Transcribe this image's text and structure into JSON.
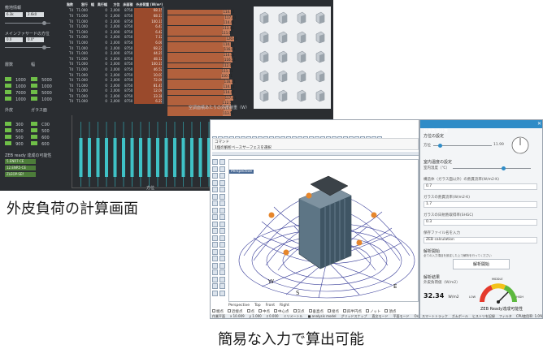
{
  "captions": {
    "left": "外皮負荷の計算画面",
    "right": "簡易な入力で算出可能"
  },
  "dashboard": {
    "sec1_label": "敷地情報",
    "sec1_inputs": [
      "6.3k",
      "2.6k0"
    ],
    "sec2_label": "メインファサードの方位",
    "sec2_inputs": [
      "0.0",
      "0.0°"
    ],
    "group_left_label": "層数",
    "group_right_label": "幅",
    "group_left_values": [
      "1000",
      "1000",
      "7000",
      "1000"
    ],
    "group_right_values": [
      "5000",
      "1000",
      "5000",
      "1000"
    ],
    "group2_left_label": "外皮",
    "group2_right_label": "ガラス面",
    "group2_left_values": [
      "300",
      "500",
      "500",
      "900"
    ],
    "group2_right_values": [
      "C00",
      "500",
      "600",
      "600"
    ],
    "zeb_label": "ZEB ready 達成の可能性",
    "zeb_values": [
      "5.ENR7-CE",
      "12.ENR5-CE",
      "ZLEOP-SEf"
    ],
    "table_headers": [
      "階数",
      "窓行",
      "幅",
      "奥行幅",
      "方位",
      "床面積",
      "外皮荷重 (W/m²)"
    ],
    "table_rows": [
      [
        "T4",
        "T1.000",
        "",
        "0",
        "2,000",
        "8750",
        "68.15"
      ],
      [
        "T4",
        "T1.000",
        "",
        "0",
        "2,000",
        "8750",
        "68.17"
      ],
      [
        "T4",
        "T1.000",
        "",
        "0",
        "2,000",
        "8750",
        "100.11"
      ],
      [
        "T4",
        "T1.000",
        "",
        "0",
        "2,000",
        "8750",
        "6.47"
      ],
      [
        "T4",
        "T1.000",
        "",
        "0",
        "2,000",
        "8750",
        "6.42"
      ],
      [
        "T4",
        "T1.000",
        "",
        "0",
        "2,000",
        "8750",
        "7.12"
      ],
      [
        "T4",
        "T1.000",
        "",
        "0",
        "2,000",
        "8750",
        "6.00"
      ],
      [
        "T4",
        "T1.000",
        "",
        "0",
        "2,000",
        "8750",
        "68.22"
      ],
      [
        "T4",
        "T1.000",
        "",
        "0",
        "2,000",
        "8750",
        "44.21"
      ],
      [
        "T4",
        "T1.000",
        "",
        "0",
        "2,000",
        "8750",
        "48.12"
      ],
      [
        "T4",
        "T1.000",
        "",
        "0",
        "2,000",
        "8750",
        "100.11"
      ],
      [
        "T4",
        "T1.000",
        "",
        "0",
        "2,000",
        "8750",
        "46.52"
      ],
      [
        "T4",
        "T1.000",
        "",
        "0",
        "2,000",
        "8750",
        "10.07"
      ],
      [
        "T4",
        "T1.000",
        "",
        "0",
        "2,000",
        "8750",
        "72.06"
      ],
      [
        "T4",
        "T1.000",
        "",
        "0",
        "2,000",
        "8750",
        "81.41"
      ],
      [
        "T4",
        "T1.000",
        "",
        "0",
        "2,000",
        "8750",
        "12.08"
      ],
      [
        "T4",
        "T1.000",
        "",
        "0",
        "2,000",
        "8750",
        "33.38"
      ],
      [
        "T4",
        "T1.000",
        "",
        "0",
        "2,000",
        "8750",
        "6.22"
      ]
    ],
    "bar_values": [
      "114.11",
      "117.41",
      "114.41",
      "113.01",
      "111.07",
      "120.41",
      "114.14",
      "116.01",
      "114.51",
      "116.51",
      "112.67",
      "111.11",
      "110.11",
      "116.11",
      "114.11",
      "114.47",
      "117.61",
      "112.51",
      "114.61",
      "113.51"
    ],
    "bars_caption": "空調面積あたりの外皮荷重（W）",
    "chart_caption": "方位"
  },
  "cad": {
    "title": "外皮負荷計算",
    "menu": [
      "ファイル",
      "編集",
      "ビュー",
      "曲線",
      "サーフェス",
      "ソリッド",
      "メッシュ",
      "寸法",
      "変形",
      "ツール",
      "解析",
      "レンダリング",
      "パネル",
      "ヘルプ"
    ],
    "command_label": "コマンド",
    "command_text": "1個の解析ベースサーフェスを選択",
    "viewport_label": "Perspective",
    "directions": [
      "W",
      "S",
      "E"
    ],
    "view_tabs": [
      "Perspective",
      "Top",
      "Front",
      "Right"
    ],
    "status_items": [
      "端点",
      "近接点",
      "点",
      "中点",
      "中心点",
      "交点",
      "垂直点",
      "接点",
      "四半円点",
      "ノット",
      "頂点"
    ],
    "status_bar": [
      "作業平面",
      "x 10.009",
      "y 1.000",
      "z 0.000",
      "ミリメートル",
      "■ analysis model",
      "グリッドスナップ",
      "直交モード",
      "平面モード",
      "Osnap",
      "スマートトラック"
    ]
  },
  "dialog": {
    "title": "外皮負荷計算",
    "orientation_label": "方位の設定",
    "orientation_sublabel": "方位",
    "orientation_value": "11.99",
    "indoor_label": "室内温度の設定",
    "indoor_sublabel": "室内温度（℃）",
    "window_u_label": "構造体（ガラス面以外）の熱貫流率(W/m2·K)",
    "window_u_value": "0.7",
    "glass_u_label": "ガラスの熱貫流率(W/m2·K)",
    "glass_u_value": "1.7",
    "shgc_label": "ガラスの日射熱取得率(SHGC)",
    "shgc_value": "0.3",
    "file_label": "保存ファイル名を入力",
    "file_value": "ZEB calculation",
    "run_section_label": "解析開始",
    "run_note": "全ての入力項目を設定した上で解析を行ってください",
    "run_button": "解析開始",
    "result_label": "解析結果",
    "result_sublabel": "外皮負荷値（W/m2）",
    "result_value": "32.34",
    "result_unit": "W/m2",
    "gauge_labels": [
      "LOW",
      "MIDDLE",
      "HIGH"
    ],
    "gauge_caption": "ZEB Ready達成可能性",
    "footer": [
      "スマートトラック",
      "ガムボール",
      "ヒストリを記録",
      "フィルタ",
      "CPU使用率: 1.0%"
    ]
  }
}
